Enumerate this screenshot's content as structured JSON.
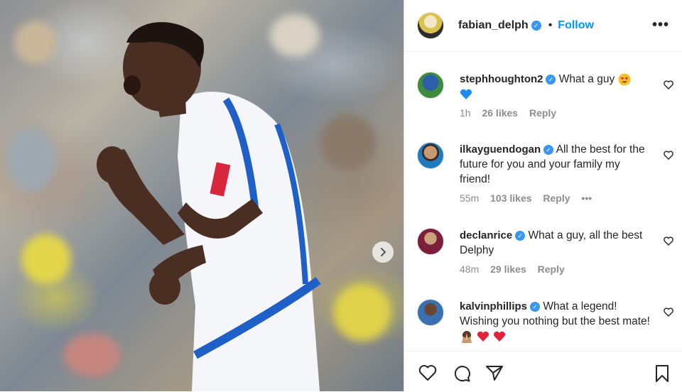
{
  "post": {
    "image_alt": "Footballer in white and blue kit celebrating in front of crowd",
    "next_icon": "chevron-right-icon"
  },
  "header": {
    "username": "fabian_delph",
    "verified": true,
    "separator": "•",
    "follow_label": "Follow",
    "more_label": "•••"
  },
  "comments": [
    {
      "username": "stephhoughton2",
      "verified": true,
      "text": "What a guy",
      "emoji": [
        "heart-eyes-emoji",
        "blue-heart-emoji"
      ],
      "time": "1h",
      "likes": "26 likes",
      "reply": "Reply"
    },
    {
      "username": "ilkayguendogan",
      "verified": true,
      "text": "All the best for the future for you and your family my friend!",
      "time": "55m",
      "likes": "103 likes",
      "reply": "Reply",
      "more": "•••"
    },
    {
      "username": "declanrice",
      "verified": true,
      "text": "What a guy, all the best Delphy",
      "time": "48m",
      "likes": "29 likes",
      "reply": "Reply"
    },
    {
      "username": "kalvinphillips",
      "verified": true,
      "text": "What a legend! Wishing you nothing but the best mate!",
      "emoji": [
        "praying-hands-emoji",
        "red-heart-emoji",
        "red-heart-emoji"
      ]
    }
  ],
  "actions": {
    "like_icon": "heart-icon",
    "comment_icon": "comment-icon",
    "share_icon": "paper-plane-icon",
    "save_icon": "bookmark-icon"
  },
  "colors": {
    "accent": "#0095f6",
    "verified": "#3897f0",
    "muted": "#8e8e8e",
    "kit_blue": "#1f5fc8"
  }
}
